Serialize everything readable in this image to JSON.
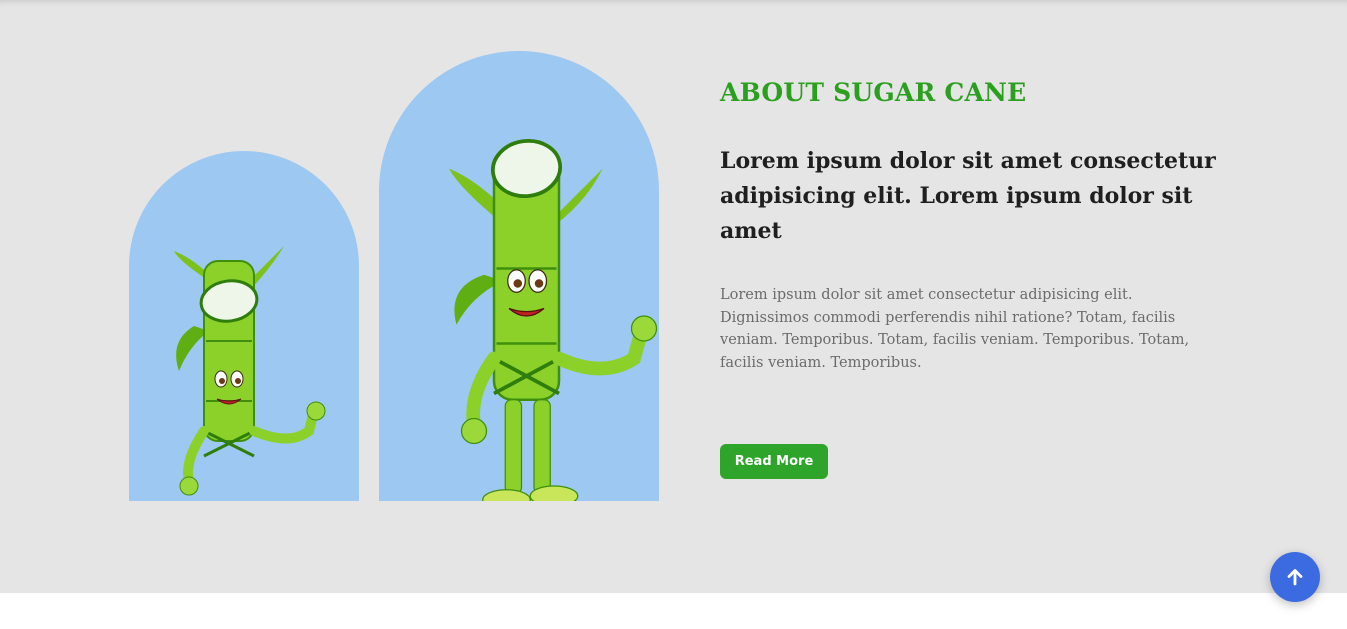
{
  "about": {
    "eyebrow": "ABOUT SUGAR CANE",
    "headline": "Lorem ipsum dolor sit amet consectetur adipisicing elit. Lorem ipsum dolor sit amet",
    "body": "Lorem ipsum dolor sit amet consectetur adipisicing elit. Dignissimos commodi perferendis nihil ratione? Totam, facilis veniam. Temporibus. Totam, facilis veniam. Temporibus. Totam, facilis veniam. Temporibus.",
    "read_more_label": "Read More"
  },
  "images": {
    "small_alt": "sugar cane mascot",
    "large_alt": "sugar cane mascot"
  },
  "scroll_top": {
    "icon": "arrow-up-icon"
  },
  "colors": {
    "section_bg": "#e6e5e5",
    "arch_bg": "#9dc8f2",
    "accent_green": "#2aa01e",
    "button_green": "#2ea52a",
    "scroll_button_blue": "#3c6ae0"
  }
}
